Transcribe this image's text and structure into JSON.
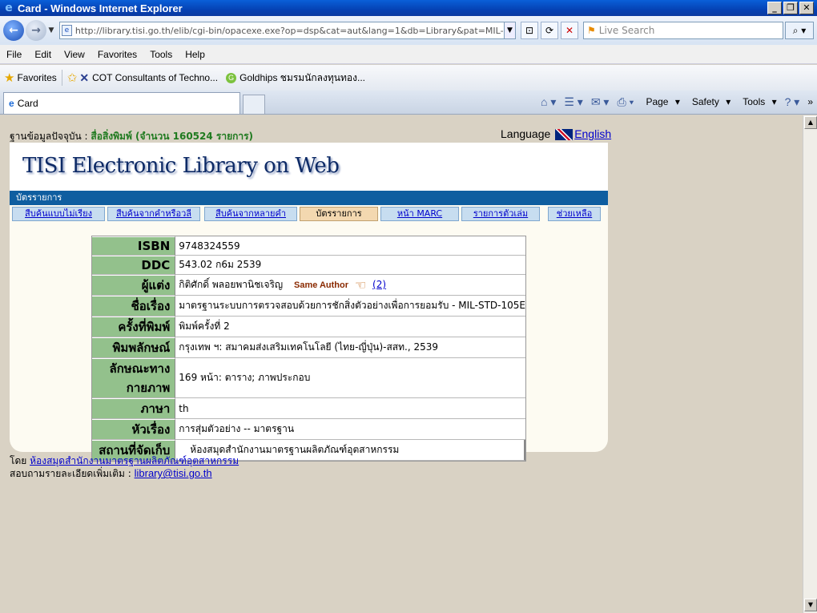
{
  "window": {
    "title": "Card - Windows Internet Explorer",
    "address_url": "http://library.tisi.go.th/elib/cgi-bin/opacexe.exe?op=dsp&cat=aut&lang=1&db=Library&pat=MIL-STD-105E",
    "search_placeholder": "Live Search"
  },
  "menu": [
    "File",
    "Edit",
    "View",
    "Favorites",
    "Tools",
    "Help"
  ],
  "favorites": {
    "label": "Favorites",
    "items": [
      "COT  Consultants of Techno...",
      "Goldhips ชมรมนักลงทุนทอง..."
    ]
  },
  "tab": {
    "label": "Card"
  },
  "commandbar": {
    "page": "Page",
    "safety": "Safety",
    "tools": "Tools"
  },
  "page": {
    "db_label": "ฐานข้อมูลปัจจุบัน : ",
    "db_value": "สื่อสิ่งพิมพ์ (จำนวน 160524 รายการ)",
    "language_label": "Language",
    "language_link": "English",
    "logo": "TISI Electronic Library on Web",
    "section_title": "บัตรรายการ",
    "nav_tabs": [
      "สืบค้นแบบไม่เรียง",
      "สืบค้นจากคำหรือวลี",
      "สืบค้นจากหลายคำ",
      "บัตรรายการ",
      "หน้า MARC",
      "รายการตัวเล่ม",
      "ช่วยเหลือ"
    ],
    "record": {
      "isbn_label": "ISBN",
      "isbn": "9748324559",
      "ddc_label": "DDC",
      "ddc": "543.02 ก6ม 2539",
      "author_label": "ผู้แต่ง",
      "author": "กิติศักดิ์ พลอยพานิชเจริญ",
      "same_author": "Same Author",
      "same_author_count": "(2)",
      "title_label": "ชื่อเรื่อง",
      "title": "มาตรฐานระบบการตรวจสอบด้วยการชักสิ่งตัวอย่างเพื่อการยอมรับ - MIL-STD-105E",
      "edition_label": "ครั้งที่พิมพ์",
      "edition": "พิมพ์ครั้งที่ 2",
      "publisher_label": "พิมพลักษณ์",
      "publisher": "กรุงเทพ ฯ: สมาคมส่งเสริมเทคโนโลยี (ไทย-ญี่ปุ่น)-สสท., 2539",
      "physical_label": "ลักษณะทางกายภาพ",
      "physical": "169 หน้า: ตาราง; ภาพประกอบ",
      "language_label": "ภาษา",
      "language": "th",
      "subject_label": "หัวเรื่อง",
      "subject": "การสุ่มตัวอย่าง -- มาตรฐาน",
      "location_label": "สถานที่จัดเก็บ",
      "location": "ห้องสมุดสำนักงานมาตรฐานผลิตภัณฑ์อุตสาหกรรม"
    },
    "footer_by": "โดย ",
    "footer_by_link": "ห้องสมุดสำนักงานมาตรฐานผลิตภัณฑ์อุตสาหกรรม",
    "footer_contact": "สอบถามรายละเอียดเพิ่มเติม : ",
    "footer_email": "library@tisi.go.th"
  }
}
